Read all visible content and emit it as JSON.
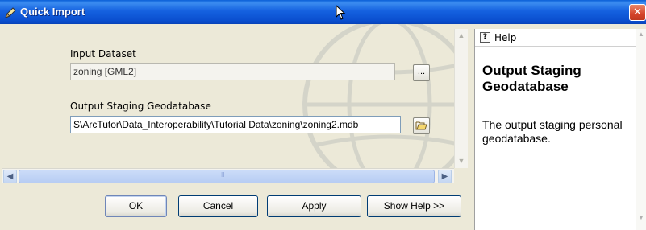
{
  "window": {
    "title": "Quick Import",
    "close_glyph": "✕"
  },
  "form": {
    "input_dataset": {
      "label": "Input Dataset",
      "value": "zoning [GML2]",
      "browse_label": "..."
    },
    "output_geodatabase": {
      "label": "Output Staging Geodatabase",
      "value": "S\\ArcTutor\\Data_Interoperability\\Tutorial Data\\zoning\\zoning2.mdb"
    }
  },
  "scrollbar": {
    "grip": "III"
  },
  "buttons": {
    "ok": "OK",
    "cancel": "Cancel",
    "apply": "Apply",
    "show_help": "Show Help >>"
  },
  "help": {
    "tab_label": "Help",
    "icon_glyph": "?",
    "title": "Output Staging Geodatabase",
    "body": "The output staging personal geodatabase."
  },
  "icons": {
    "title": "pencil-icon",
    "browse_folder": "open-folder-icon",
    "cursor": "mouse-pointer-icon"
  },
  "colors": {
    "titlebar": "#0a4fcf",
    "close": "#d5442a",
    "dialog_bg": "#ece9d8",
    "scroll_thumb": "#b7cdf3"
  }
}
